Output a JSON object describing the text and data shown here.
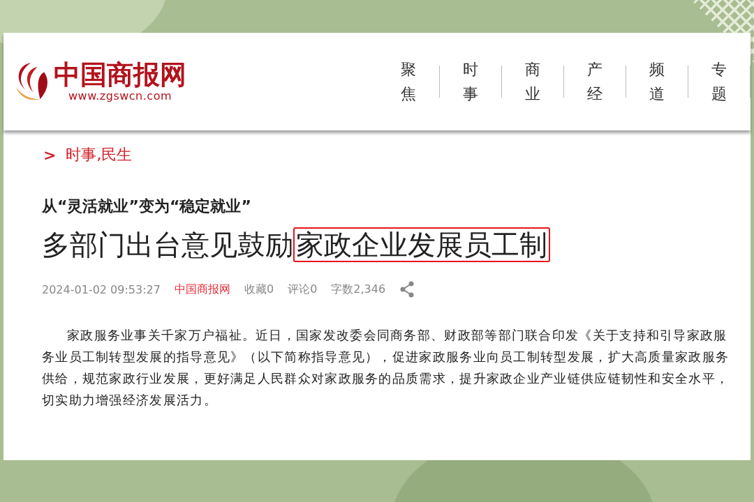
{
  "site": {
    "name": "中国商报网",
    "url": "www.zgswcn.com"
  },
  "nav": [
    {
      "label": "聚焦"
    },
    {
      "label": "时事"
    },
    {
      "label": "商业"
    },
    {
      "label": "产经"
    },
    {
      "label": "频道"
    },
    {
      "label": "专题"
    }
  ],
  "breadcrumb": {
    "marker": ">",
    "text": "时事,民生"
  },
  "article": {
    "subtitle": "从“灵活就业”变为“稳定就业”",
    "title": [
      {
        "text": "多部门出台意见鼓励",
        "highlighted": false
      },
      {
        "text": "家政企业发展员工制",
        "highlighted": true
      }
    ],
    "meta": {
      "date": "2024-01-02 09:53:27",
      "source": "中国商报网",
      "favorites": "收藏0",
      "comments": "评论0",
      "words": "字数2,346"
    },
    "body": "家政服务业事关千家万户福祉。近日，国家发改委会同商务部、财政部等部门联合印发《关于支持和引导家政服务业员工制转型发展的指导意见》（以下简称指导意见），促进家政服务业向员工制转型发展，扩大高质量家政服务供给，规范家政行业发展，更好满足人民群众对家政服务的品质需求，提升家政企业产业链供应链韧性和安全水平，切实助力增强经济发展活力。"
  }
}
